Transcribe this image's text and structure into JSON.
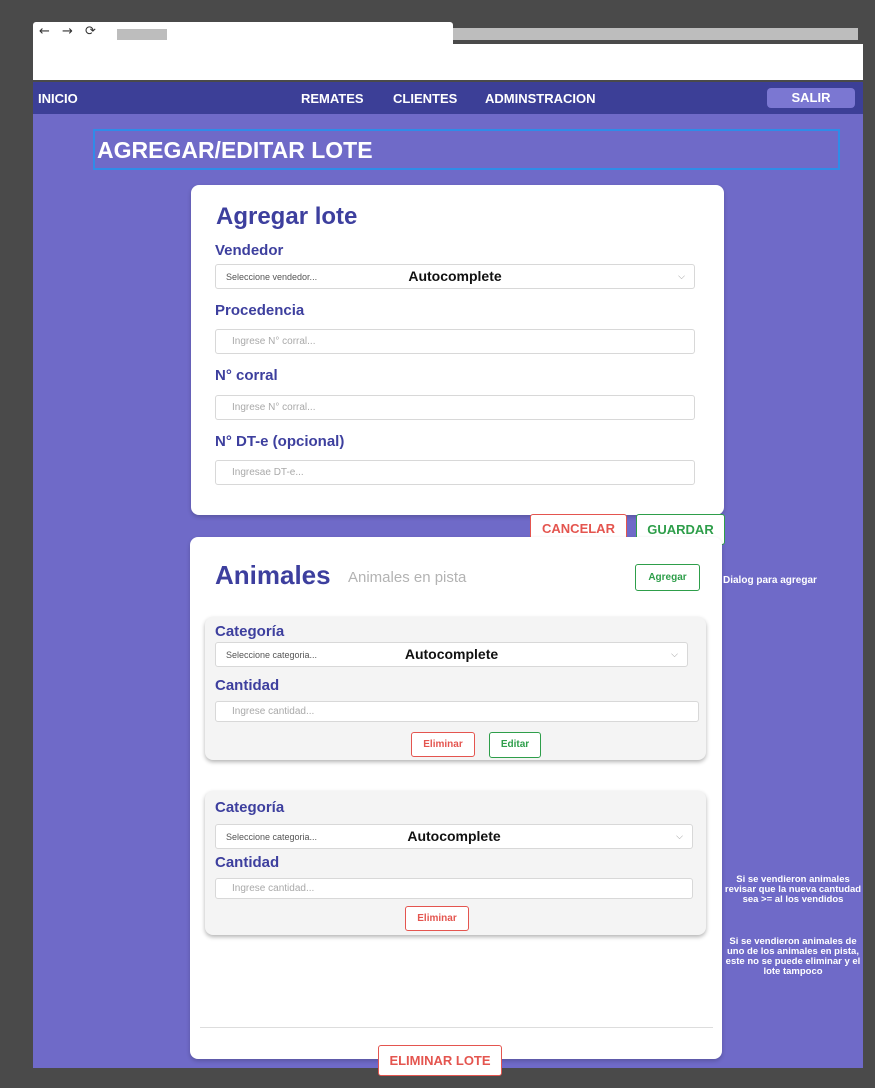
{
  "browser": {
    "nav_icons": "← → ⟳"
  },
  "topnav": {
    "inicio": "INICIO",
    "remates": "REMATES",
    "clientes": "CLIENTES",
    "administracion": "ADMINSTRACION",
    "salir": "SALIR"
  },
  "page_title": "AGREGAR/EDITAR LOTE",
  "lote_form": {
    "title": "Agregar lote",
    "vendedor": {
      "label": "Vendedor",
      "placeholder": "Seleccione vendedor...",
      "annotation": "Autocomplete"
    },
    "procedencia": {
      "label": "Procedencia",
      "placeholder": "Ingrese N° corral..."
    },
    "corral": {
      "label": "N° corral",
      "placeholder": "Ingrese N° corral..."
    },
    "dte": {
      "label": "N° DT-e (opcional)",
      "placeholder": "Ingresae DT-e..."
    }
  },
  "actions": {
    "cancel": "CANCELAR",
    "save": "GUARDAR"
  },
  "animales": {
    "title": "Animales",
    "subtitle": "Animales en pista",
    "add": "Agregar",
    "items": [
      {
        "categoria_label": "Categoría",
        "categoria_placeholder": "Seleccione categoria...",
        "annotation": "Autocomplete",
        "cantidad_label": "Cantidad",
        "cantidad_placeholder": "Ingrese cantidad...",
        "delete": "Eliminar",
        "edit": "Editar"
      },
      {
        "categoria_label": "Categoría",
        "categoria_placeholder": "Seleccione categoria...",
        "annotation": "Autocomplete",
        "cantidad_label": "Cantidad",
        "cantidad_placeholder": "Ingrese cantidad...",
        "delete": "Eliminar"
      }
    ],
    "delete_lote": "ELIMINAR LOTE"
  },
  "notes": {
    "dialog": "Dialog para agregar",
    "note1": "Si se vendieron animales revisar que la nueva cantudad sea >= al los vendidos",
    "note2": "Si se vendieron animales de uno de los animales en pista, este no se puede eliminar y el lote tampoco"
  },
  "colors": {
    "app_bg": "#6f6ac8",
    "nav_bg": "#3c3f97",
    "heading": "#3d3f9e",
    "danger": "#e4554f",
    "success": "#2e9e4a"
  }
}
